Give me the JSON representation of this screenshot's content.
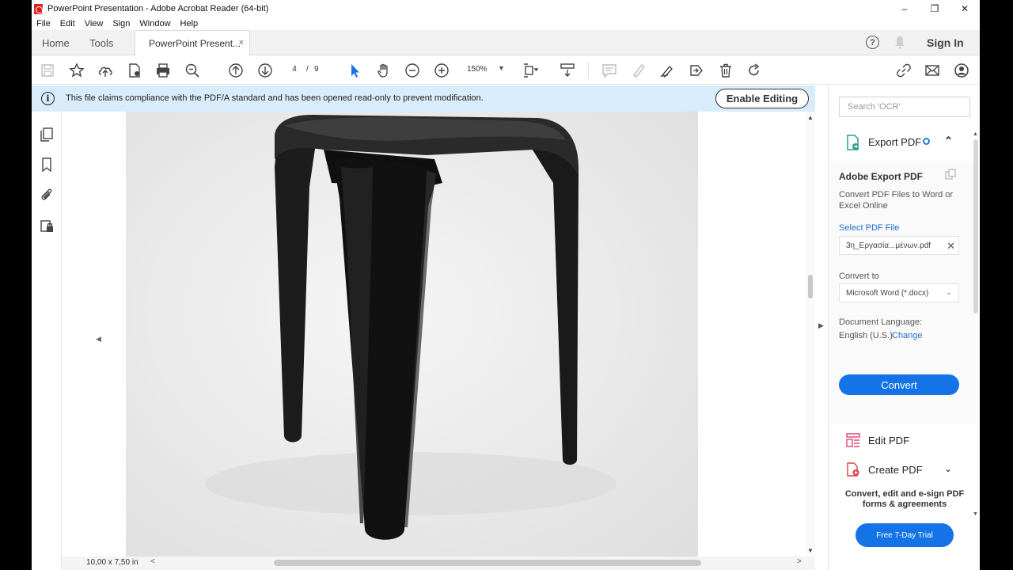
{
  "window": {
    "title": "PowerPoint Presentation - Adobe Acrobat Reader (64-bit)",
    "minimize": "–",
    "restore": "❐",
    "close": "✕"
  },
  "menu": [
    "File",
    "Edit",
    "View",
    "Sign",
    "Window",
    "Help"
  ],
  "tabs": {
    "home": "Home",
    "tools": "Tools",
    "doc": "PowerPoint Present...",
    "close": "×"
  },
  "header": {
    "help": "?",
    "signin": "Sign In"
  },
  "toolbar": {
    "page_current": "4",
    "page_sep": "/",
    "page_total": "9",
    "zoom": "150%",
    "zoom_caret": "▼"
  },
  "banner": {
    "icon": "i",
    "text": "This file claims compliance with the PDF/A standard and has been opened read-only to prevent modification.",
    "enable_label": "Enable Editing"
  },
  "status": {
    "page_size": "10,00 x 7,50 in",
    "scroll_left": "<",
    "scroll_right": ">"
  },
  "right_panel": {
    "search_placeholder": "Search 'OCR'",
    "export": {
      "label": "Export PDF",
      "chevron": "⌃"
    },
    "adobe_export": {
      "title": "Adobe Export PDF",
      "description": "Convert PDF Files to Word or Excel Online",
      "select_link": "Select PDF File",
      "file": "3η_Εργασία...μένων.pdf",
      "file_remove": "✕",
      "convert_to_label": "Convert to",
      "convert_to_value": "Microsoft Word (*.docx)",
      "select_caret": "⌄",
      "language_label": "Document Language:",
      "language_value": "English (U.S.)",
      "change_link": "Change",
      "convert_button": "Convert"
    },
    "tools": [
      {
        "label": "Edit PDF"
      },
      {
        "label": "Create PDF",
        "chevron": "⌄"
      }
    ],
    "promo": "Convert, edit and e-sign PDF forms & agreements",
    "trial_button": "Free 7-Day Trial"
  },
  "colors": {
    "accent": "#1473e6",
    "banner": "#d9ecfb",
    "link": "#1f6fd0",
    "stool": "#151515"
  },
  "arrows": {
    "collapse_left": "◀",
    "collapse_right": "▶",
    "scroll_up": "▲",
    "scroll_down": "▼"
  }
}
